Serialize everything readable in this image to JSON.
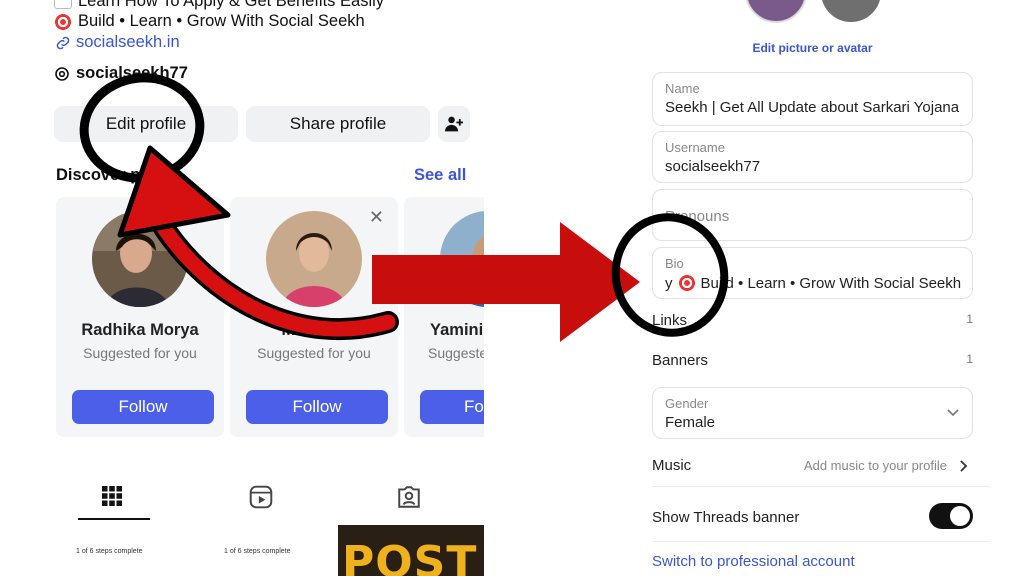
{
  "profile": {
    "bio_line1": "Learn How To Apply & Get Benefits Easily",
    "bio_line2": "Build • Learn • Grow With Social Seekh",
    "link": "socialseekh.in",
    "threads_handle": "socialseekh77",
    "edit_profile": "Edit profile",
    "share_profile": "Share profile"
  },
  "discover": {
    "title": "Discover people",
    "see_all": "See all",
    "cards": [
      {
        "name": "Radhika Morya",
        "sub": "Suggested for you",
        "follow": "Follow"
      },
      {
        "name": "Makeo...",
        "sub": "Suggested for you",
        "follow": "Follow"
      },
      {
        "name": "Yamini",
        "sub": "Suggeste",
        "follow": "Fo"
      }
    ]
  },
  "steps": {
    "label1": "1 of 6 steps complete",
    "label2": "1 of 6 steps complete"
  },
  "post_thumb_text": "POST",
  "edit_form": {
    "edit_picture": "Edit picture or avatar",
    "name_label": "Name",
    "name_value": "Seekh | Get All Update about Sarkari Yojana",
    "username_label": "Username",
    "username_value": "socialseekh77",
    "pronouns_label": "Pronouns",
    "bio_label": "Bio",
    "bio_value": "Build • Learn • Grow With Social Seekh",
    "bio_prefix": "y",
    "links_label": "Links",
    "links_count": "1",
    "banners_label": "Banners",
    "banners_count": "1",
    "gender_label": "Gender",
    "gender_value": "Female",
    "music_label": "Music",
    "music_placeholder": "Add music to your profile",
    "threads_banner_label": "Show Threads banner",
    "switch_pro": "Switch to professional account"
  },
  "colors": {
    "accent": "#3a55d6",
    "follow_button": "#4b5fe8",
    "arrow_red": "#c80d0d",
    "annotation_black": "#000000"
  }
}
